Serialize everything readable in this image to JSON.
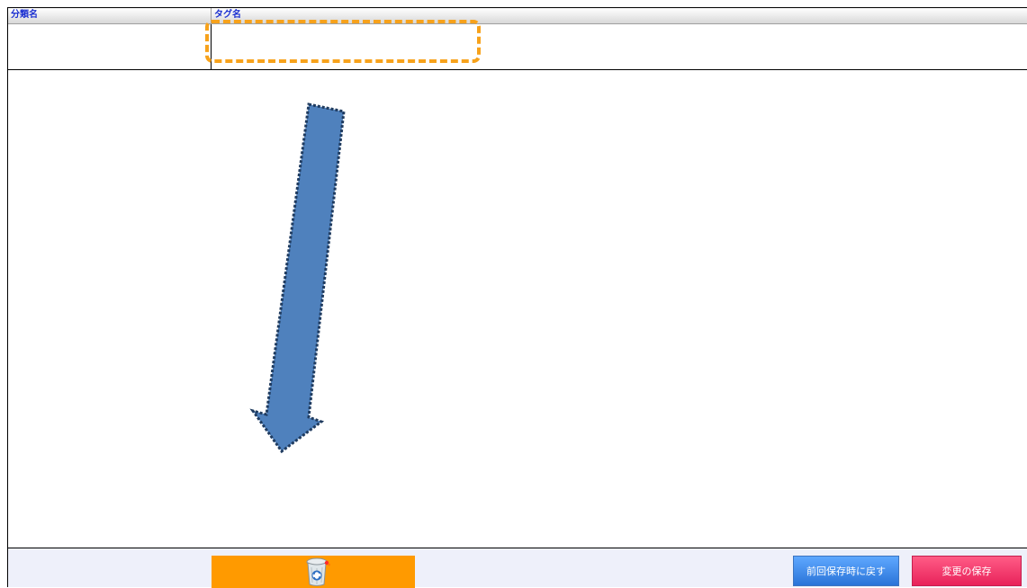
{
  "table": {
    "columns": [
      {
        "label": "分類名"
      },
      {
        "label": "タグ名"
      }
    ],
    "rows": [
      {
        "category": "",
        "tag": ""
      }
    ]
  },
  "footer": {
    "trash_icon": "trash-bin-recycle-icon",
    "revert_label": "前回保存時に戻す",
    "save_label": "変更の保存"
  },
  "annotations": {
    "highlight_color": "#f7a21b",
    "arrow_color": "#4f81bd"
  },
  "colors": {
    "header_text": "#1a2fd1",
    "trash_button_bg": "#ff9a00",
    "revert_button_bg": "#3d8cf0",
    "save_button_bg": "#f03a6c",
    "footer_bg": "#eef0fa"
  }
}
